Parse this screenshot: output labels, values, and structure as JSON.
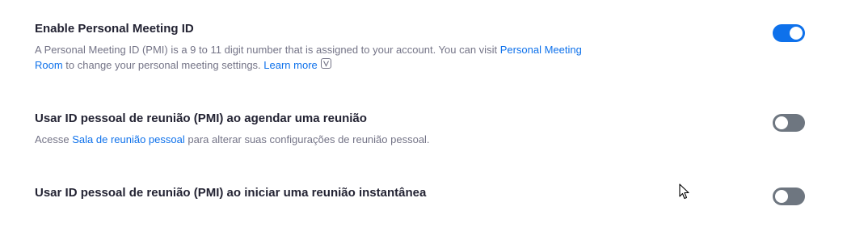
{
  "settings": [
    {
      "title": "Enable Personal Meeting ID",
      "desc_part1": "A Personal Meeting ID (PMI) is a 9 to 11 digit number that is assigned to your account. You can visit ",
      "desc_link1": "Personal Meeting Room",
      "desc_part2": " to change your personal meeting settings. ",
      "desc_link2": "Learn more",
      "enabled": true
    },
    {
      "title": "Usar ID pessoal de reunião (PMI) ao agendar uma reunião",
      "desc_part1": "Acesse ",
      "desc_link1": "Sala de reunião pessoal",
      "desc_part2": " para alterar suas configurações de reunião pessoal.",
      "enabled": false
    },
    {
      "title": "Usar ID pessoal de reunião (PMI) ao iniciar uma reunião instantânea",
      "enabled": false
    }
  ],
  "colors": {
    "toggle_on": "#0e71eb",
    "toggle_off": "#6e7680",
    "link": "#0e71eb"
  }
}
